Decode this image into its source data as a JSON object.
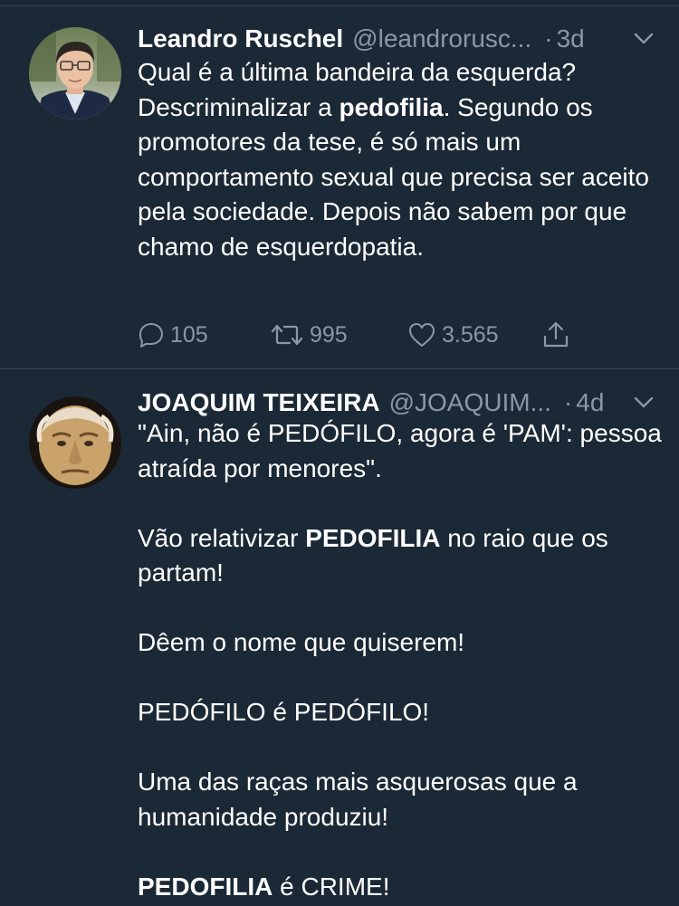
{
  "tweets": [
    {
      "author_name": "Leandro Ruschel",
      "handle": "@leandroruschel",
      "handle_display": "@leandrorusc...",
      "separator": "·",
      "time": "3d",
      "body": {
        "p1_pre": "Qual é a última bandeira da esquerda? Descriminalizar a ",
        "p1_bold": "pedofilia",
        "p1_post": ". Segundo os promotores da tese, é só mais um comportamento sexual que precisa ser aceito pela sociedade. Depois não sabem por que chamo de esquerdopatia."
      },
      "actions": {
        "replies": "105",
        "retweets": "995",
        "likes": "3.565"
      }
    },
    {
      "author_name": "JOAQUIM TEIXEIRA",
      "handle_display": "@JOAQUIM...",
      "separator": "·",
      "time": "4d",
      "body": {
        "p1": "\"Ain, não é PEDÓFILO, agora é 'PAM': pessoa atraída por menores\".",
        "p2_pre": "Vão relativizar ",
        "p2_bold": "PEDOFILIA",
        "p2_post": " no raio que os partam!",
        "p3": "Dêem o nome que quiserem!",
        "p4": "PEDÓFILO é PEDÓFILO!",
        "p5": "Uma das raças mais asquerosas que a humanidade produziu!",
        "p6_bold": "PEDOFILIA",
        "p6_post": " é CRIME!"
      }
    }
  ],
  "icons": {
    "reply": "speech-bubble-icon",
    "retweet": "retweet-arrows-icon",
    "like": "heart-icon",
    "share": "share-upload-icon",
    "menu": "chevron-down-icon"
  },
  "colors": {
    "background": "#1b2836",
    "text": "#ffffff",
    "secondary": "#8899a6",
    "divider": "#38444d"
  }
}
